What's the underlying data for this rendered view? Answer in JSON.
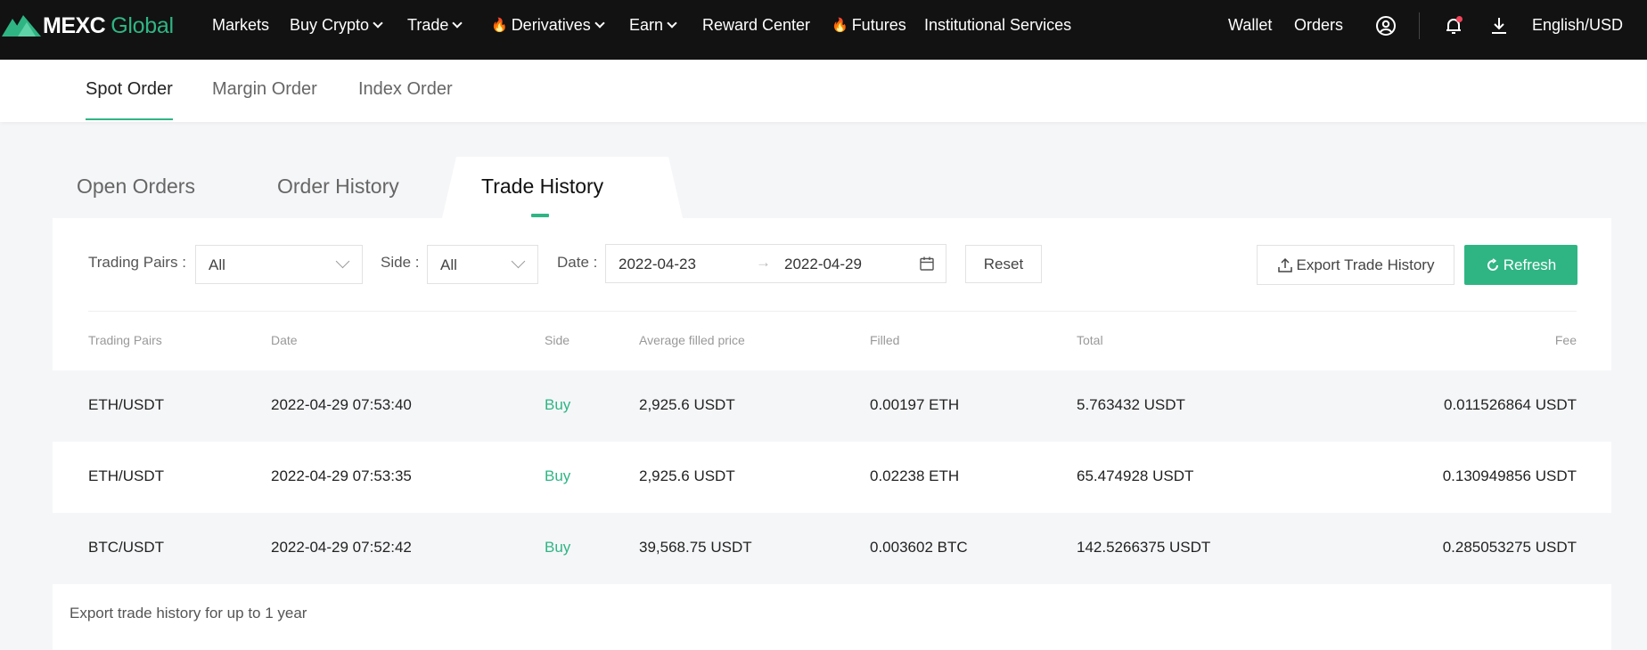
{
  "brand": {
    "name": "MEXC",
    "suffix": "Global",
    "accent": "#2fb584"
  },
  "nav": {
    "items": [
      {
        "label": "Markets",
        "dropdown": false,
        "hot": false
      },
      {
        "label": "Buy Crypto",
        "dropdown": true,
        "hot": false
      },
      {
        "label": "Trade",
        "dropdown": true,
        "hot": false
      },
      {
        "label": "Derivatives",
        "dropdown": true,
        "hot": true
      },
      {
        "label": "Earn",
        "dropdown": true,
        "hot": false
      },
      {
        "label": "Reward Center",
        "dropdown": false,
        "hot": false
      },
      {
        "label": "Futures",
        "dropdown": false,
        "hot": true
      },
      {
        "label": "Institutional Services",
        "dropdown": false,
        "hot": false
      }
    ],
    "wallet": "Wallet",
    "orders": "Orders",
    "language": "English/USD",
    "icons": [
      "user-icon",
      "bell-icon",
      "download-icon"
    ]
  },
  "subnav": {
    "tabs": [
      "Spot Order",
      "Margin Order",
      "Index Order"
    ],
    "active": "Spot Order"
  },
  "tabs": {
    "items": [
      "Open Orders",
      "Order History",
      "Trade History"
    ],
    "active": "Trade History"
  },
  "filters": {
    "pairs_label": "Trading Pairs",
    "pairs_value": "All",
    "side_label": "Side",
    "side_value": "All",
    "date_label": "Date",
    "date_start": "2022-04-23",
    "date_end": "2022-04-29",
    "reset": "Reset",
    "export": "Export Trade History",
    "refresh": "Refresh"
  },
  "table": {
    "headers": [
      "Trading Pairs",
      "Date",
      "Side",
      "Average filled price",
      "Filled",
      "Total",
      "Fee"
    ],
    "rows": [
      [
        "ETH/USDT",
        "2022-04-29 07:53:40",
        "Buy",
        "2,925.6 USDT",
        "0.00197 ETH",
        "5.763432 USDT",
        "0.011526864 USDT"
      ],
      [
        "ETH/USDT",
        "2022-04-29 07:53:35",
        "Buy",
        "2,925.6 USDT",
        "0.02238 ETH",
        "65.474928 USDT",
        "0.130949856 USDT"
      ],
      [
        "BTC/USDT",
        "2022-04-29 07:52:42",
        "Buy",
        "39,568.75 USDT",
        "0.003602 BTC",
        "142.5266375 USDT",
        "0.285053275 USDT"
      ]
    ]
  },
  "footnote": "Export trade history for up to 1 year"
}
